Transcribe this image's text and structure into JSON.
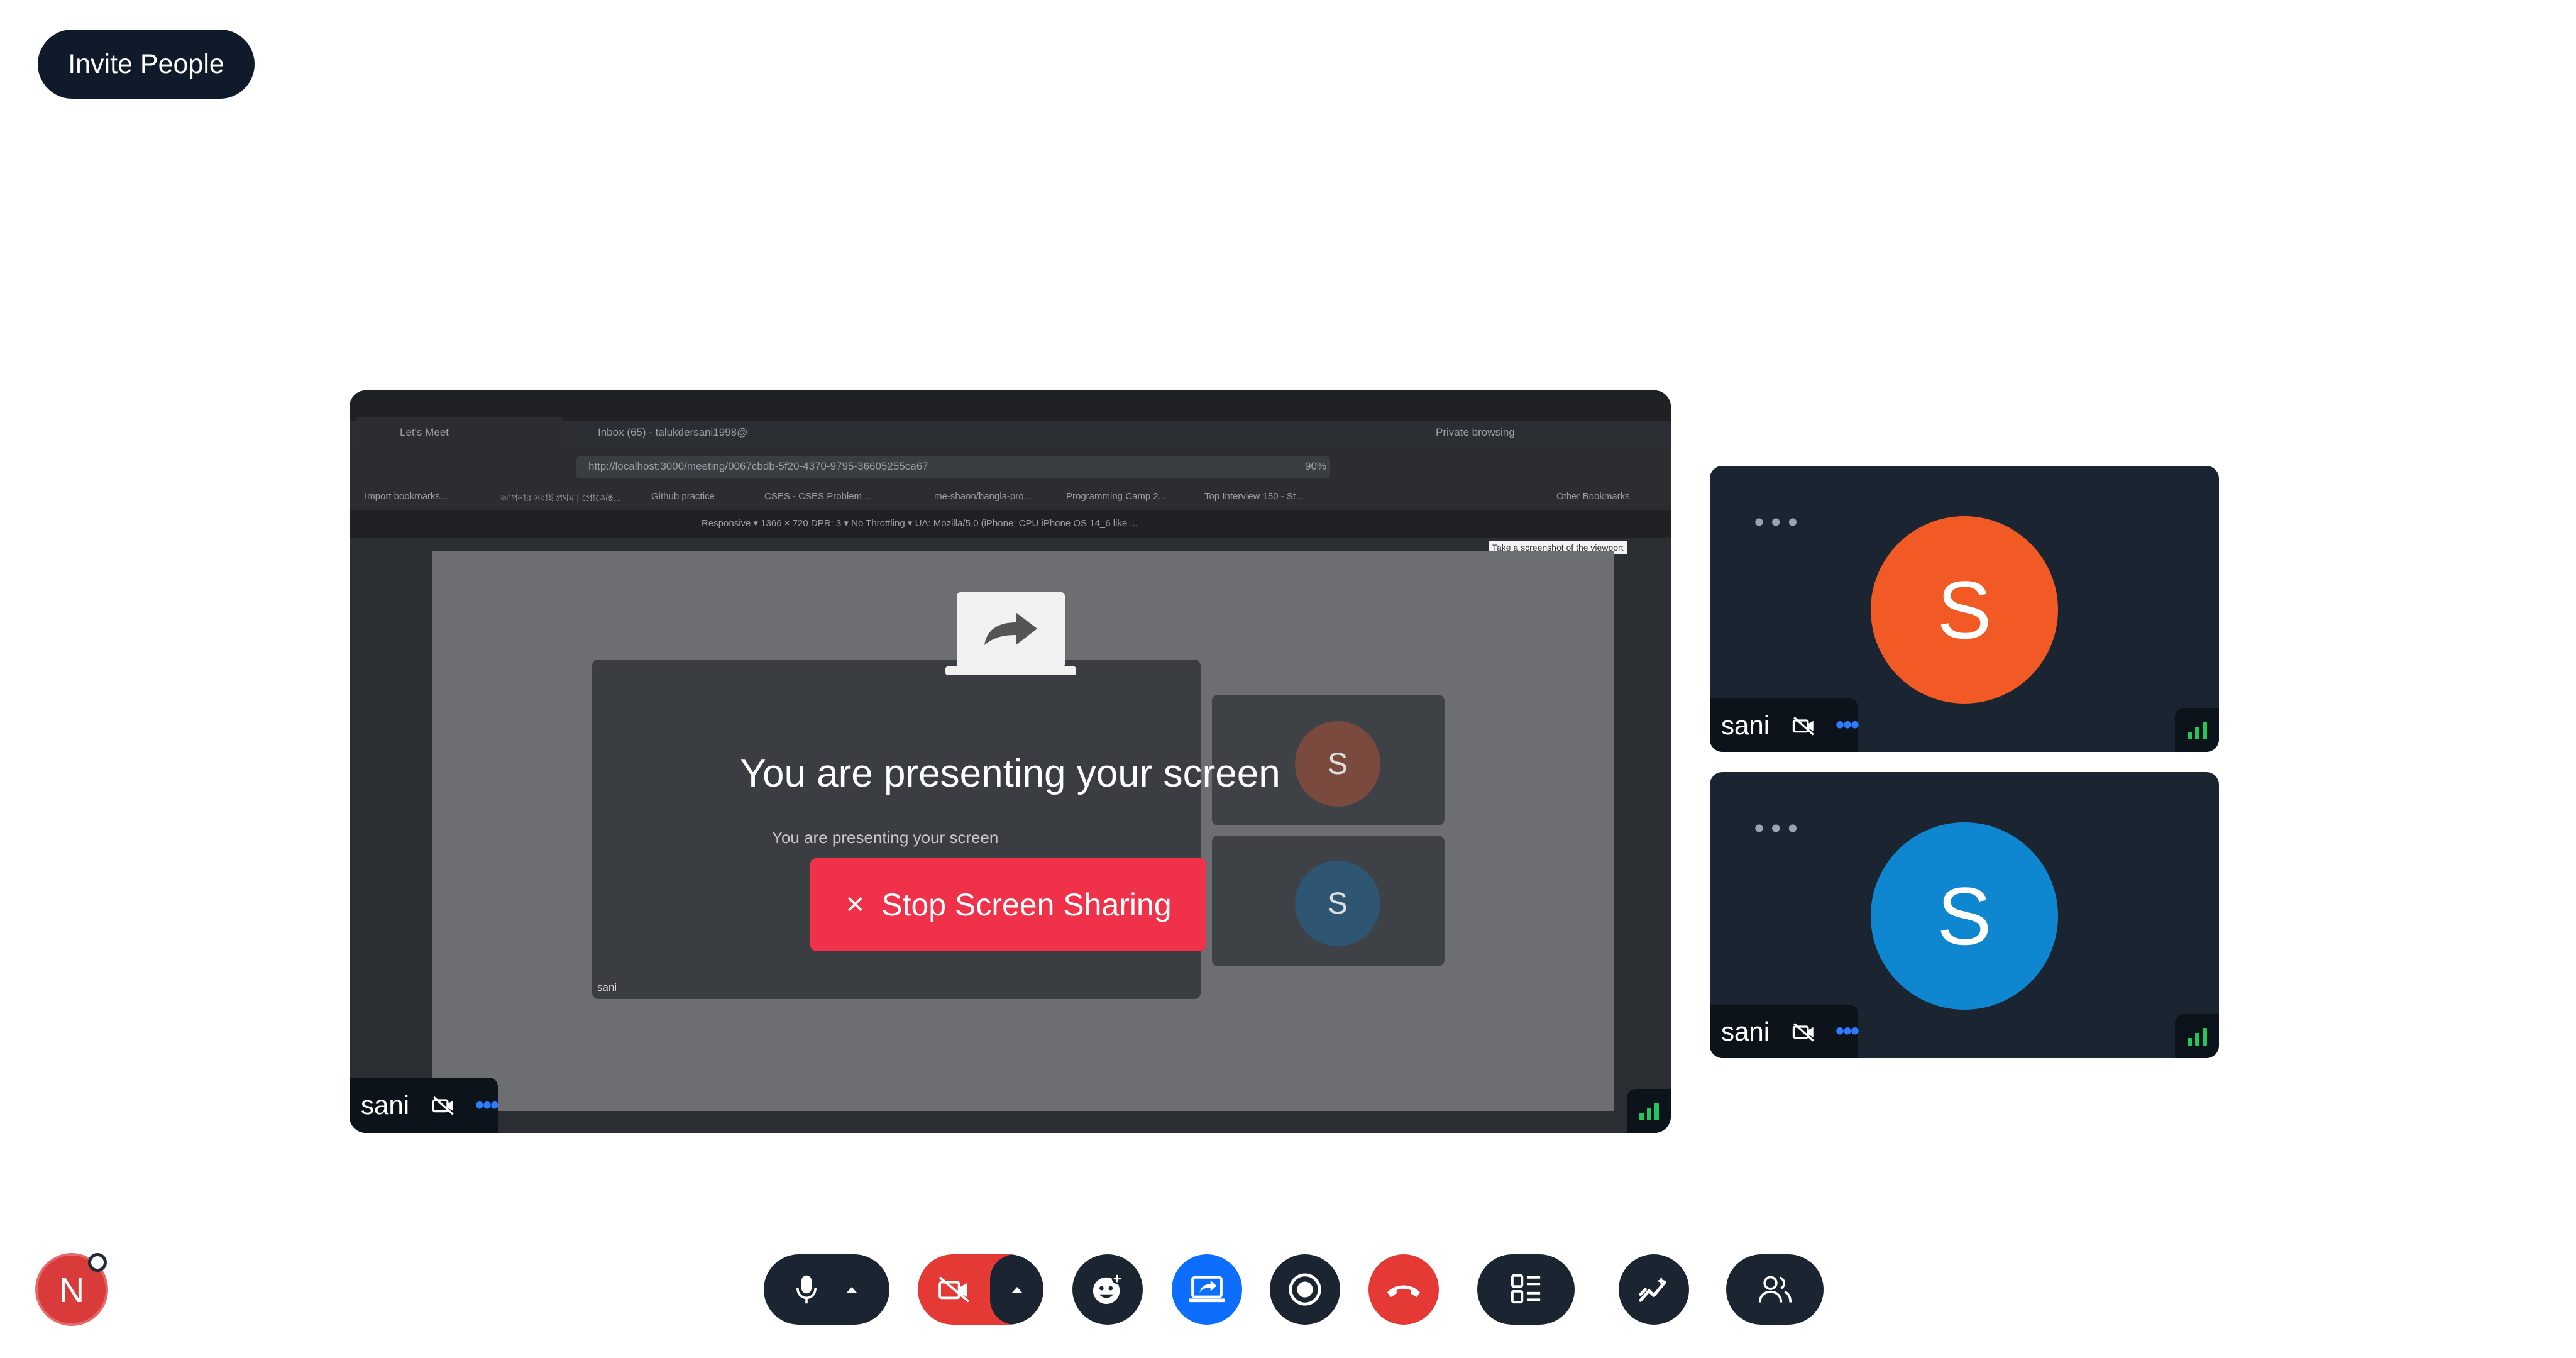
{
  "header": {
    "invite_label": "Invite People"
  },
  "screenshot_content": {
    "tabs": [
      "Let's Meet",
      "Inbox (65) - talukdersani1998@"
    ],
    "private_label": "Private browsing",
    "url": "http://localhost:3000/meeting/0067cbdb-5f20-4370-9795-36605255ca67",
    "zoom": "90%",
    "bookmarks": [
      "Import bookmarks...",
      "আপনার সবাই প্রথম | প্রোজেক্ট...",
      "Github practice",
      "CSES - CSES Problem ...",
      "me-shaon/bangla-pro...",
      "Programming Camp 2...",
      "Top Interview 150 - St..."
    ],
    "other_bookmarks": "Other Bookmarks",
    "devtools": "Responsive ▾   1366  ×  720   DPR: 3 ▾  No Throttling ▾  UA: Mozilla/5.0 (iPhone; CPU iPhone OS 14_6 like ...",
    "tooltip": "Take a screenshot of the viewport",
    "inner_presenting": "You are presenting your screen",
    "inner_initials": [
      "S",
      "S"
    ],
    "inner_name": "sani"
  },
  "main_tile": {
    "presenting_text": "You are presenting your screen",
    "stop_label": "Stop Screen Sharing",
    "stop_icon": "close-icon",
    "participant_name": "sani"
  },
  "side_tiles": [
    {
      "initial": "S",
      "name": "sani",
      "color": "#f15a24"
    },
    {
      "initial": "S",
      "name": "sani",
      "color": "#0f87d0"
    }
  ],
  "footer": {
    "user_initial": "N",
    "controls": [
      "mic-icon",
      "chevron-up-icon",
      "camera-off-icon",
      "emoji-add-icon",
      "screen-share-icon",
      "record-icon",
      "end-call-icon",
      "layout-icon",
      "whiteboard-icon",
      "participants-icon"
    ]
  },
  "colors": {
    "dark": "#1b2532",
    "navy": "#0f1b2b",
    "stop_red": "#f0314a",
    "share_blue": "#0d6efd",
    "end_red": "#e53935",
    "signal_green": "#22c55e"
  }
}
